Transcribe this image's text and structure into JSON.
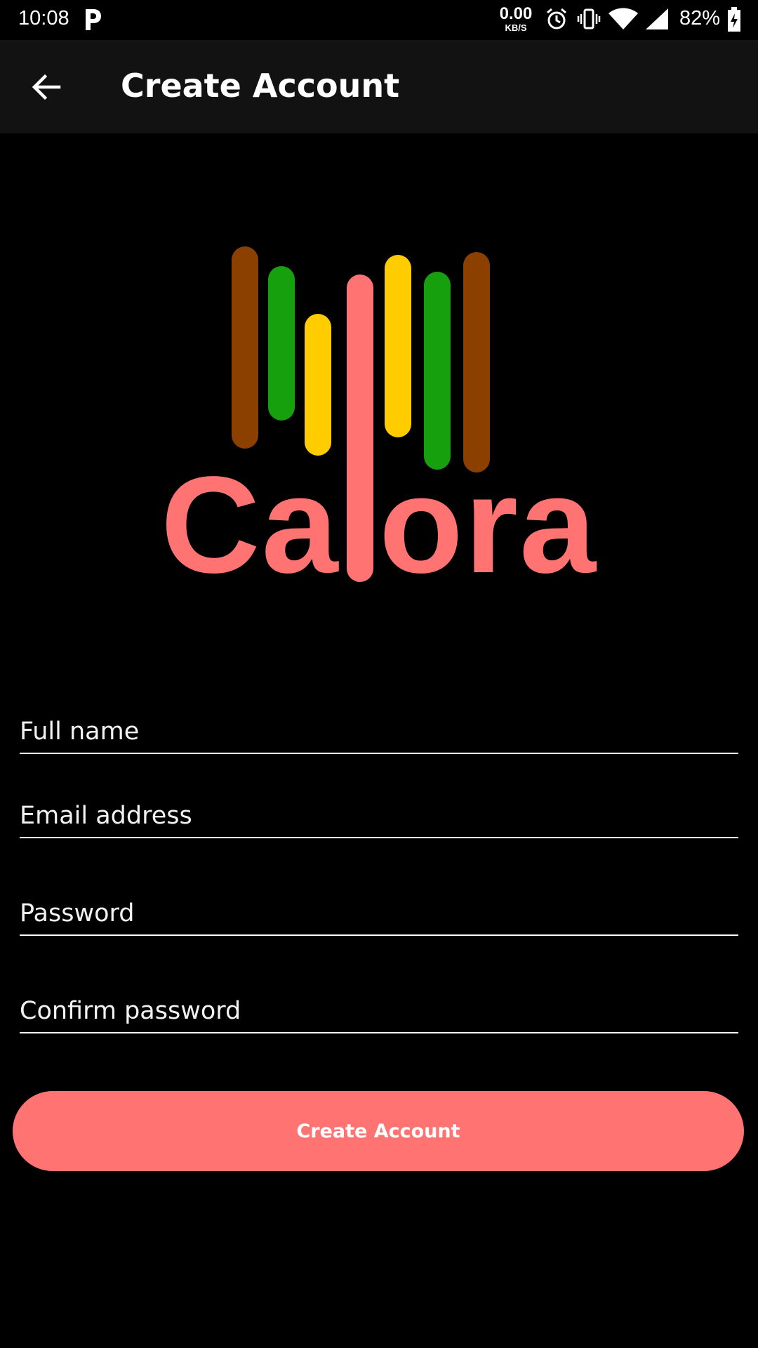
{
  "status_bar": {
    "time": "10:08",
    "net_speed_value": "0.00",
    "net_speed_unit": "KB/S",
    "battery": "82%",
    "icons": [
      "parking-p-icon",
      "alarm-icon",
      "vibrate-icon",
      "wifi-icon",
      "signal-icon",
      "battery-charging-icon"
    ]
  },
  "app_bar": {
    "title": "Create Account",
    "back_icon": "arrow-left-icon"
  },
  "logo": {
    "wordmark": "Calora",
    "colors": {
      "brown": "#8b4000",
      "green": "#16a00e",
      "yellow": "#ffcc00",
      "coral": "#ff7373"
    }
  },
  "form": {
    "full_name_placeholder": "Full name",
    "email_placeholder": "Email address",
    "password_placeholder": "Password",
    "confirm_password_placeholder": "Confirm password",
    "full_name_value": "",
    "email_value": "",
    "password_value": "",
    "confirm_password_value": "",
    "submit_label": "Create Account"
  },
  "theme": {
    "background": "#000000",
    "app_bar": "#121212",
    "accent": "#ff7373"
  }
}
